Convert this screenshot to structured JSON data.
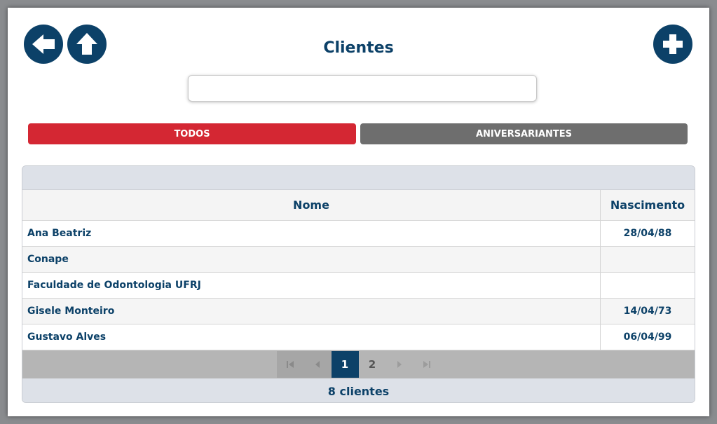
{
  "header": {
    "title": "Clientes",
    "back_icon": "arrow-left-icon",
    "home_icon": "arrow-up-icon",
    "add_icon": "plus-icon"
  },
  "search": {
    "value": "",
    "placeholder": ""
  },
  "tabs": [
    {
      "label": "TODOS",
      "active": true,
      "color": "#d42733"
    },
    {
      "label": "ANIVERSARIANTES",
      "active": false,
      "color": "#6e6e6e"
    }
  ],
  "table": {
    "columns": [
      "Nome",
      "Nascimento"
    ],
    "rows": [
      {
        "nome": "Ana Beatriz",
        "nascimento": "28/04/88"
      },
      {
        "nome": "Conape",
        "nascimento": ""
      },
      {
        "nome": "Faculdade de Odontologia UFRJ",
        "nascimento": ""
      },
      {
        "nome": "Gisele Monteiro",
        "nascimento": "14/04/73"
      },
      {
        "nome": "Gustavo Alves",
        "nascimento": "06/04/99"
      }
    ]
  },
  "pager": {
    "first_icon": "first-page-icon",
    "prev_icon": "prev-page-icon",
    "next_icon": "next-page-icon",
    "last_icon": "last-page-icon",
    "pages": [
      "1",
      "2"
    ],
    "current": "1"
  },
  "footer": {
    "count_text": "8 clientes"
  },
  "colors": {
    "brand": "#0c4168",
    "accent": "#d42733",
    "secondary": "#6e6e6e"
  }
}
